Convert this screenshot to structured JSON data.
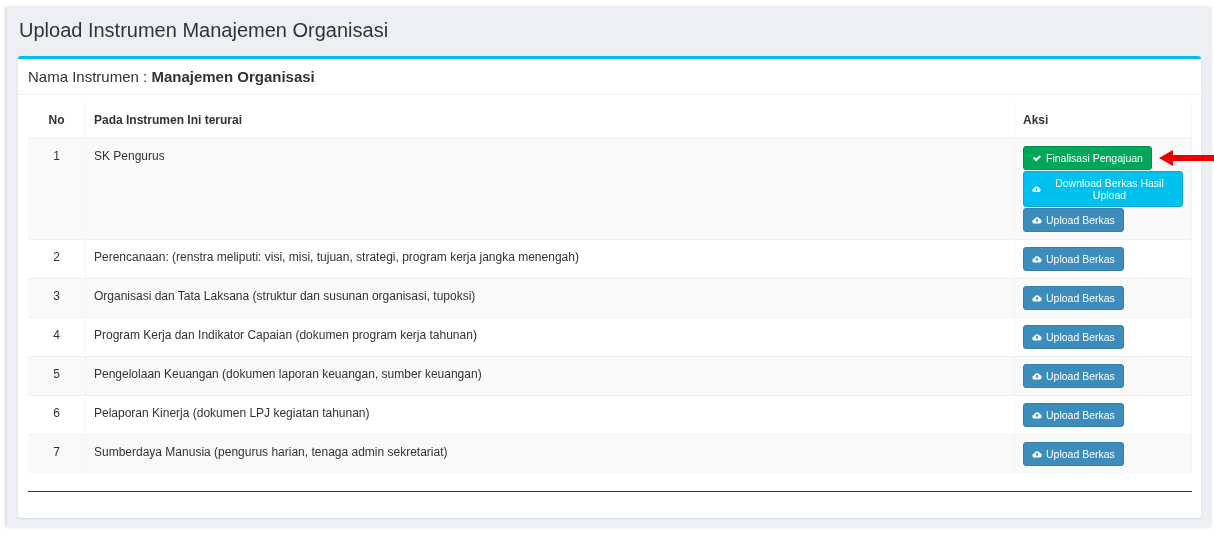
{
  "page_title": "Upload Instrumen Manajemen Organisasi",
  "card": {
    "label": "Nama Instrumen :",
    "value": "Manajemen Organisasi"
  },
  "table": {
    "columns": [
      "No",
      "Pada Instrumen Ini terurai",
      "Aksi"
    ],
    "rows": [
      {
        "no": "1",
        "item": "SK Pengurus",
        "actions": [
          {
            "kind": "finalize",
            "label": "Finalisasi Pengajuan",
            "highlighted": true
          },
          {
            "kind": "download",
            "label": "Download Berkas Hasil Upload"
          },
          {
            "kind": "upload",
            "label": "Upload Berkas"
          }
        ]
      },
      {
        "no": "2",
        "item": "Perencanaan: (renstra meliputi: visi, misi, tujuan, strategi, program kerja jangka menengah)",
        "actions": [
          {
            "kind": "upload",
            "label": "Upload Berkas"
          }
        ]
      },
      {
        "no": "3",
        "item": "Organisasi dan Tata Laksana (struktur dan susunan organisasi, tupoksi)",
        "actions": [
          {
            "kind": "upload",
            "label": "Upload Berkas"
          }
        ]
      },
      {
        "no": "4",
        "item": "Program Kerja dan Indikator Capaian (dokumen program kerja tahunan)",
        "actions": [
          {
            "kind": "upload",
            "label": "Upload Berkas"
          }
        ]
      },
      {
        "no": "5",
        "item": "Pengelolaan Keuangan (dokumen laporan keuangan, sumber keuangan)",
        "actions": [
          {
            "kind": "upload",
            "label": "Upload Berkas"
          }
        ]
      },
      {
        "no": "6",
        "item": "Pelaporan Kinerja (dokumen LPJ kegiatan tahunan)",
        "actions": [
          {
            "kind": "upload",
            "label": "Upload Berkas"
          }
        ]
      },
      {
        "no": "7",
        "item": "Sumberdaya Manusia (pengurus harian, tenaga admin sekretariat)",
        "actions": [
          {
            "kind": "upload",
            "label": "Upload Berkas"
          }
        ]
      }
    ]
  }
}
